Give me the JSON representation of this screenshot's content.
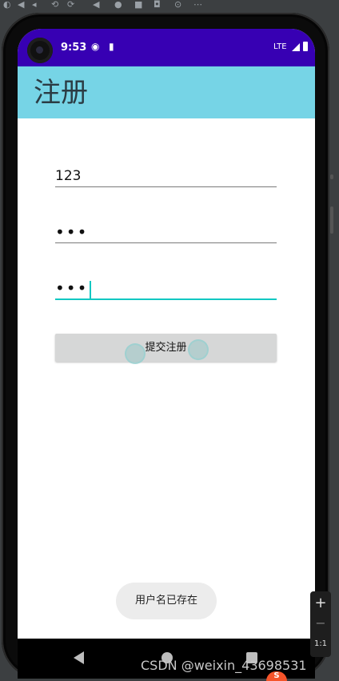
{
  "status_bar": {
    "time": "9:53",
    "network": "LTE"
  },
  "app_bar": {
    "title": "注册"
  },
  "form": {
    "username_value": "123",
    "password_value": "•••",
    "confirm_password_value": "•••",
    "submit_label": "提交注册"
  },
  "toast": {
    "message": "用户名已存在"
  },
  "emulator_zoom": {
    "zoom_in": "+",
    "zoom_out": "−",
    "actual_size": "1:1"
  },
  "watermark": {
    "text": "CSDN @weixin_43698531"
  },
  "colors": {
    "status_bar": "#3700b3",
    "app_bar": "#76d4e6",
    "focus_underline": "#12c8c2",
    "button": "#d6d7d7"
  }
}
